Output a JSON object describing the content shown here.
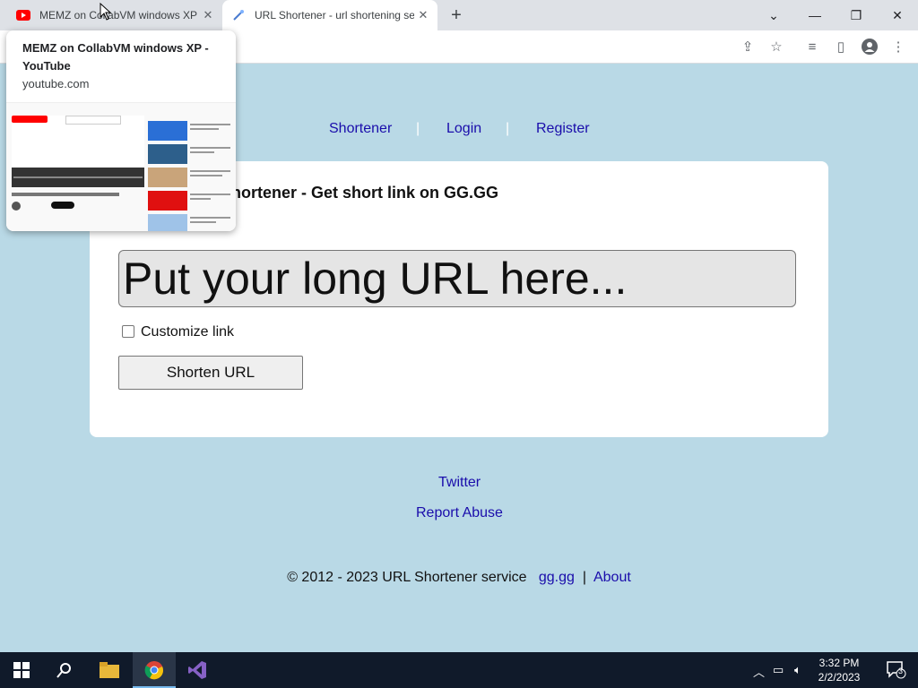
{
  "browser": {
    "tabs": [
      {
        "title": "MEMZ on CollabVM windows XP",
        "favicon": "youtube-icon"
      },
      {
        "title": "URL Shortener - url shortening se",
        "favicon": "link-icon"
      }
    ],
    "new_tab_label": "+"
  },
  "hover_card": {
    "title": "MEMZ on CollabVM windows XP - YouTube",
    "domain": "youtube.com"
  },
  "nav": {
    "shortener": "Shortener",
    "login": "Login",
    "register": "Register",
    "separator": "|"
  },
  "main": {
    "title": "URL Shortener - Get short link on GG.GG",
    "visible_title": "hortener - Get short link on GG.GG",
    "url_placeholder": "Put your long URL here...",
    "customize_label": "Customize link",
    "customize_checked": false,
    "shorten_button": "Shorten URL"
  },
  "footer": {
    "twitter": "Twitter",
    "report": "Report Abuse",
    "copyright": "© 2012 - 2023 URL Shortener service",
    "site_link": "gg.gg",
    "separator": "|",
    "about": "About"
  },
  "taskbar": {
    "time": "3:32 PM",
    "date": "2/2/2023",
    "notification_count": "3"
  },
  "colors": {
    "page_bg": "#b9d9e6",
    "link": "#1a0dab",
    "taskbar": "#101a2a"
  }
}
